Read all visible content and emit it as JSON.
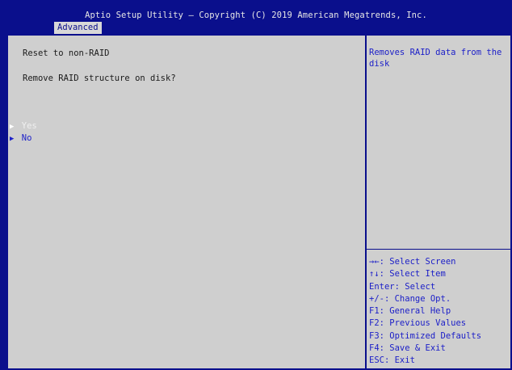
{
  "header": {
    "title": "Aptio Setup Utility – Copyright (C) 2019 American Megatrends, Inc.",
    "tab": "Advanced"
  },
  "main": {
    "heading": "Reset to non-RAID",
    "question": "Remove RAID structure on disk?",
    "options": [
      {
        "label": "Yes",
        "selected": true
      },
      {
        "label": "No",
        "selected": false
      }
    ]
  },
  "help": {
    "description": "Removes RAID data from the disk"
  },
  "keys": [
    "→←: Select Screen",
    "↑↓: Select Item",
    "Enter: Select",
    "+/-: Change Opt.",
    "F1: General Help",
    "F2: Previous Values",
    "F3: Optimized Defaults",
    "F4: Save & Exit",
    "ESC: Exit"
  ],
  "colors": {
    "background": "#0a0f8c",
    "panel": "#cfcfcf",
    "accent": "#1d20c8"
  },
  "icons": {
    "option_marker": "triangle-right-icon"
  }
}
